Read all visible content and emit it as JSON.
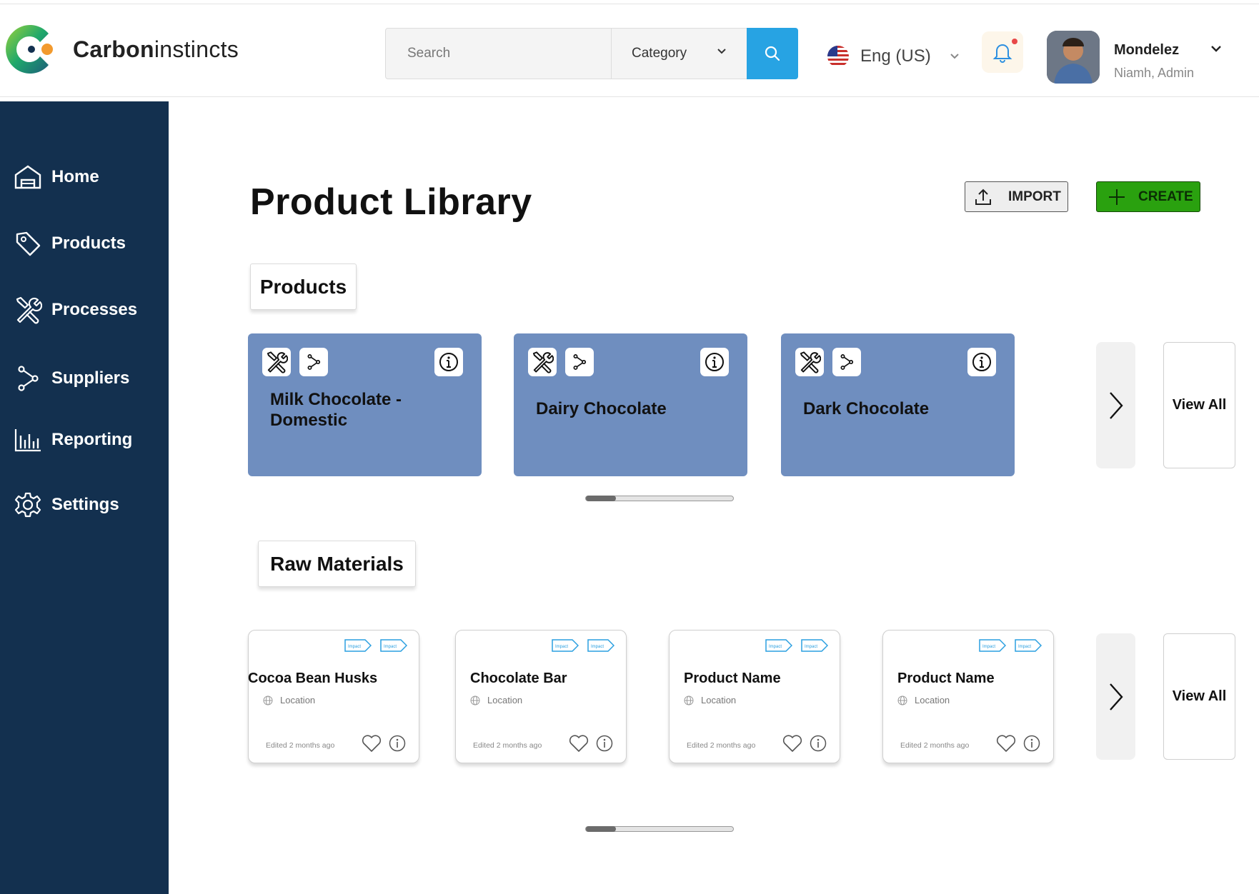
{
  "app": {
    "brand_bold": "Carbon",
    "brand_light": "instincts"
  },
  "header": {
    "search_placeholder": "Search",
    "category_label": "Category",
    "language_label": "Eng (US)",
    "user_name": "Mondelez",
    "user_role": "Niamh, Admin"
  },
  "sidebar": {
    "items": [
      {
        "label": "Home",
        "icon": "home-icon"
      },
      {
        "label": "Products",
        "icon": "tag-icon"
      },
      {
        "label": "Processes",
        "icon": "tools-icon"
      },
      {
        "label": "Suppliers",
        "icon": "branch-icon"
      },
      {
        "label": "Reporting",
        "icon": "bar-chart-icon"
      },
      {
        "label": "Settings",
        "icon": "gear-icon"
      }
    ]
  },
  "main": {
    "title": "Product Library",
    "import_label": "IMPORT",
    "create_label": "CREATE",
    "products_section": {
      "title": "Products",
      "cards": [
        {
          "name_line1": "Milk Chocolate -",
          "name_line2": "Domestic"
        },
        {
          "name_line1": "Dairy Chocolate",
          "name_line2": ""
        },
        {
          "name_line1": "Dark Chocolate",
          "name_line2": ""
        }
      ],
      "view_all": "View All",
      "scroll_fraction": 0.2
    },
    "raw_section": {
      "title": "Raw Materials",
      "tag_label": "Impact",
      "cards": [
        {
          "name": "Cocoa Bean Husks",
          "location": "Location",
          "edited": "Edited 2 months ago"
        },
        {
          "name": "Chocolate Bar",
          "location": "Location",
          "edited": "Edited 2 months ago"
        },
        {
          "name": "Product Name",
          "location": "Location",
          "edited": "Edited 2 months ago"
        },
        {
          "name": "Product Name",
          "location": "Location",
          "edited": "Edited 2 months ago"
        }
      ],
      "view_all": "View All",
      "scroll_fraction": 0.2
    }
  },
  "colors": {
    "sidebar_bg": "#13304f",
    "search_accent": "#27a3e3",
    "create_green": "#2aa10f",
    "product_card": "#6f8ebf"
  }
}
